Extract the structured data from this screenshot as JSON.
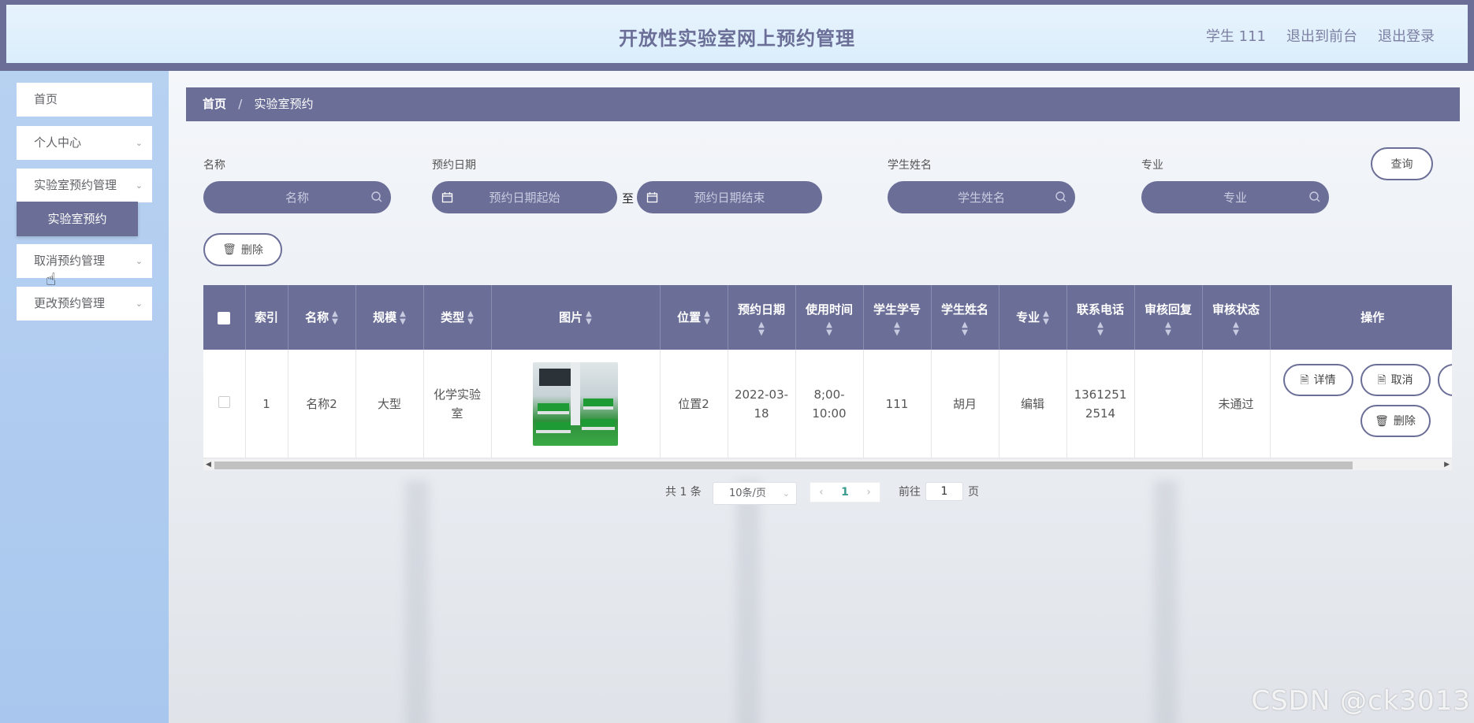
{
  "header": {
    "title": "开放性实验室网上预约管理",
    "user": "学生 111",
    "to_front": "退出到前台",
    "logout": "退出登录"
  },
  "sidebar": {
    "items": [
      {
        "label": "首页"
      },
      {
        "label": "个人中心"
      },
      {
        "label": "实验室预约管理"
      },
      {
        "label": "取消预约管理"
      },
      {
        "label": "更改预约管理"
      }
    ],
    "active_sub": "实验室预约"
  },
  "breadcrumb": {
    "home": "首页",
    "sep": "/",
    "current": "实验室预约"
  },
  "search": {
    "name_label": "名称",
    "name_placeholder": "名称",
    "date_label": "预约日期",
    "date_start_placeholder": "预约日期起始",
    "to": "至",
    "date_end_placeholder": "预约日期结束",
    "student_label": "学生姓名",
    "student_placeholder": "学生姓名",
    "major_label": "专业",
    "major_placeholder": "专业",
    "query_button": "查询"
  },
  "toolbar": {
    "delete_button": "删除"
  },
  "table": {
    "headers": [
      "索引",
      "名称",
      "规模",
      "类型",
      "图片",
      "位置",
      "预约日期",
      "使用时间",
      "学生学号",
      "学生姓名",
      "专业",
      "联系电话",
      "审核回复",
      "审核状态",
      "操作"
    ],
    "rows": [
      {
        "index": "1",
        "name": "名称2",
        "scale": "大型",
        "type": "化学实验室",
        "location": "位置2",
        "date": "2022-03-18",
        "time": "8;00-10:00",
        "student_id": "111",
        "student_name": "胡月",
        "major": "编辑",
        "phone": "13612512514",
        "reply": "",
        "status": "未通过",
        "actions": {
          "detail": "详情",
          "cancel": "取消",
          "delete": "删除"
        }
      }
    ]
  },
  "pagination": {
    "total": "共 1 条",
    "page_size": "10条/页",
    "current": "1",
    "goto_label": "前往",
    "goto_value": "1",
    "page_suffix": "页"
  },
  "watermark": "CSDN @ck3013"
}
